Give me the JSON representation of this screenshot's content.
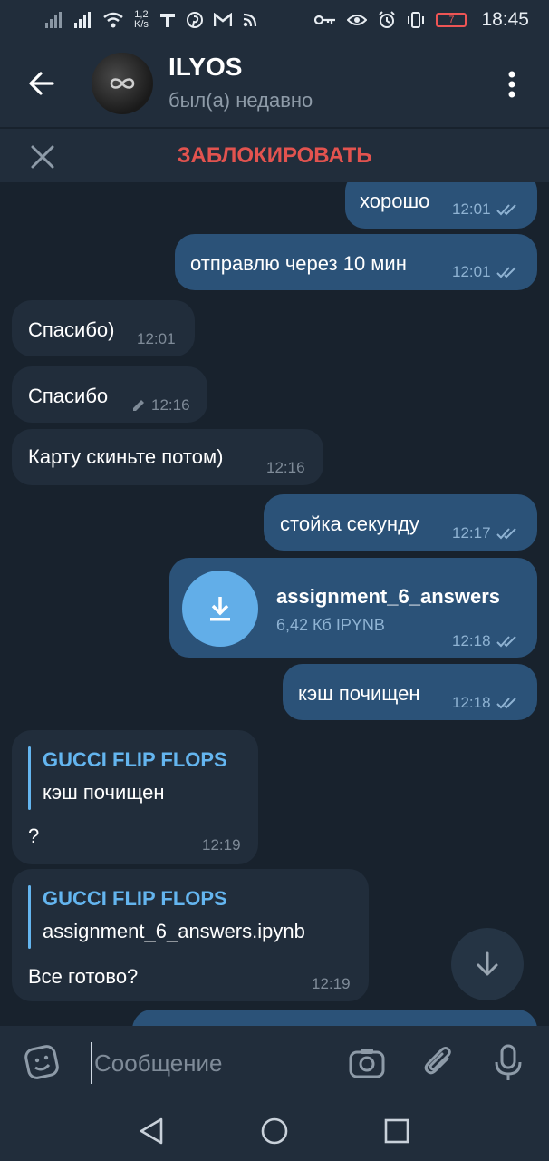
{
  "status_bar": {
    "net_speed": "1,2",
    "net_unit": "K/s",
    "battery": "7",
    "time": "18:45"
  },
  "header": {
    "name": "ILYOS",
    "status": "был(а) недавно"
  },
  "block_bar": {
    "label": "ЗАБЛОКИРОВАТЬ"
  },
  "messages": [
    {
      "dir": "out",
      "text": "хорошо",
      "time": "12:01"
    },
    {
      "dir": "out",
      "text": "отправлю через 10 мин",
      "time": "12:01"
    },
    {
      "dir": "in",
      "text": "Спасибо)",
      "time": "12:01"
    },
    {
      "dir": "in",
      "text": "Спасибо",
      "time": "12:16",
      "edited": true
    },
    {
      "dir": "in",
      "text": "Карту скиньте потом)",
      "time": "12:16"
    },
    {
      "dir": "out",
      "text": "стойка секунду",
      "time": "12:17"
    },
    {
      "dir": "out",
      "type": "file",
      "file_name": "assignment_6_answers",
      "file_info": "6,42 Кб IPYNB",
      "time": "12:18"
    },
    {
      "dir": "out",
      "text": "кэш почищен",
      "time": "12:18"
    },
    {
      "dir": "in",
      "reply_name": "GUCCI FLIP FLOPS",
      "reply_text": "кэш почищен",
      "text": "?",
      "time": "12:19"
    },
    {
      "dir": "in",
      "reply_name": "GUCCI FLIP FLOPS",
      "reply_text": "assignment_6_answers.ipynb",
      "text": "Все готово?",
      "time": "12:19"
    }
  ],
  "input": {
    "placeholder": "Сообщение"
  },
  "colors": {
    "background": "#18222d",
    "panel": "#212d3b",
    "outgoing_bubble": "#2b5278",
    "incoming_bubble": "#212d3b",
    "accent": "#64b5ef",
    "danger": "#e2534f"
  },
  "icons": [
    "back-arrow-icon",
    "more-vert-icon",
    "close-icon",
    "read-checks-icon",
    "edit-pencil-icon",
    "download-icon",
    "arrow-down-icon",
    "sticker-icon",
    "camera-icon",
    "attach-icon",
    "mic-icon",
    "nav-back-icon",
    "nav-home-icon",
    "nav-recents-icon"
  ]
}
